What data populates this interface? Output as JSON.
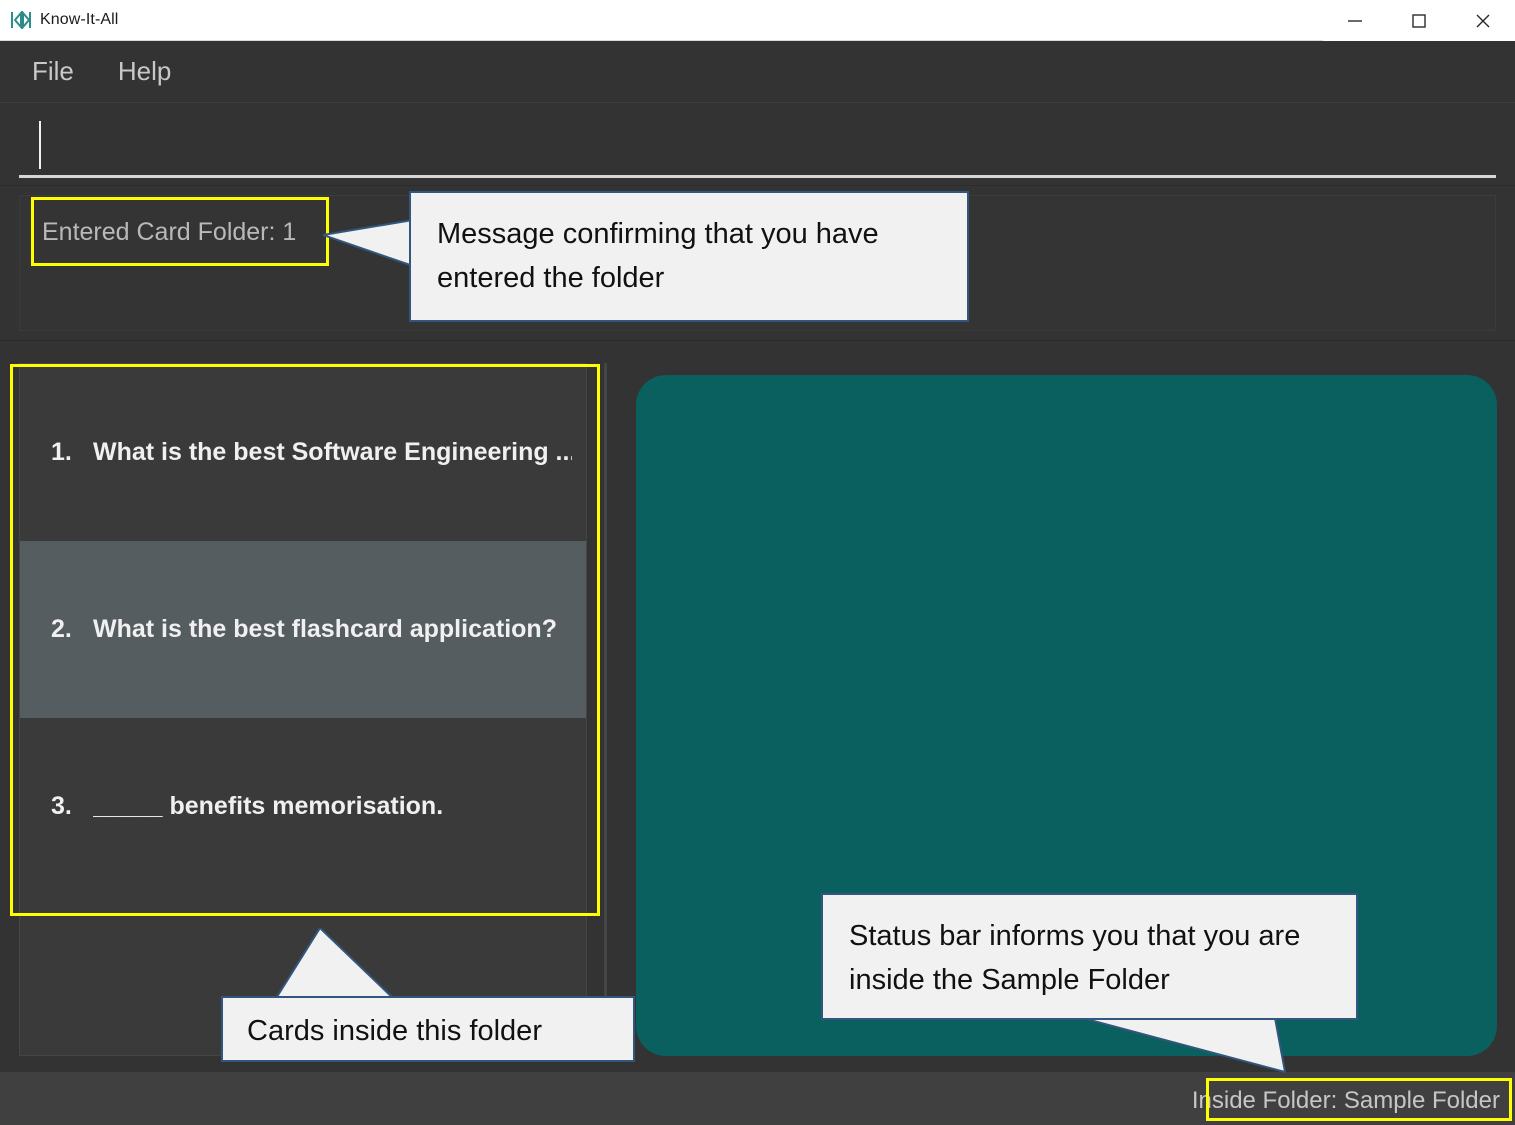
{
  "window": {
    "title": "Know-It-All",
    "icon": "app-logo-icon",
    "controls": {
      "minimize": "minimize-icon",
      "maximize": "maximize-icon",
      "close": "close-icon"
    }
  },
  "menu": {
    "items": [
      {
        "label": "File"
      },
      {
        "label": "Help"
      }
    ]
  },
  "search": {
    "value": "",
    "placeholder": ""
  },
  "message_log": {
    "text": "Entered Card Folder: 1"
  },
  "card_list": {
    "items": [
      {
        "number": "1.",
        "text": "What is the best Software Engineering ...",
        "selected": false
      },
      {
        "number": "2.",
        "text": "What is the best flashcard application?",
        "selected": true
      },
      {
        "number": "3.",
        "text": "_____ benefits memorisation.",
        "selected": false
      }
    ]
  },
  "flashcard": {
    "text": "",
    "color": "#0a5f5f"
  },
  "statusbar": {
    "text": "Inside Folder: Sample Folder"
  },
  "annotations": {
    "callout_message": "Message confirming that you have entered the folder",
    "callout_cards": "Cards inside this folder",
    "callout_status": "Status bar informs you that you are inside the Sample Folder",
    "highlight_color": "#ffff00",
    "callout_border_color": "#33567e"
  }
}
